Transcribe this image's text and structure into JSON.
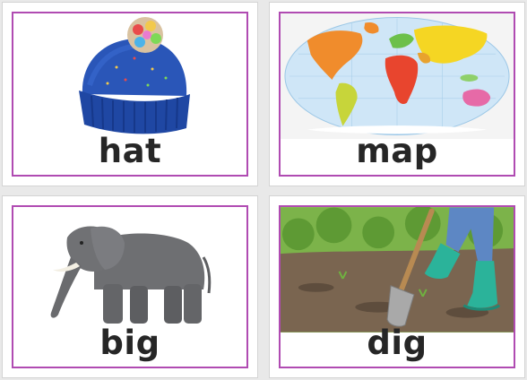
{
  "cards": [
    {
      "word": "hat",
      "image": "blue-knit-hat-icon"
    },
    {
      "word": "map",
      "image": "world-map-icon"
    },
    {
      "word": "big",
      "image": "elephant-icon"
    },
    {
      "word": "dig",
      "image": "digging-shovel-icon"
    }
  ],
  "colors": {
    "card_border": "#b04bb2",
    "word_text": "#262626",
    "background": "#e9e9e9"
  }
}
